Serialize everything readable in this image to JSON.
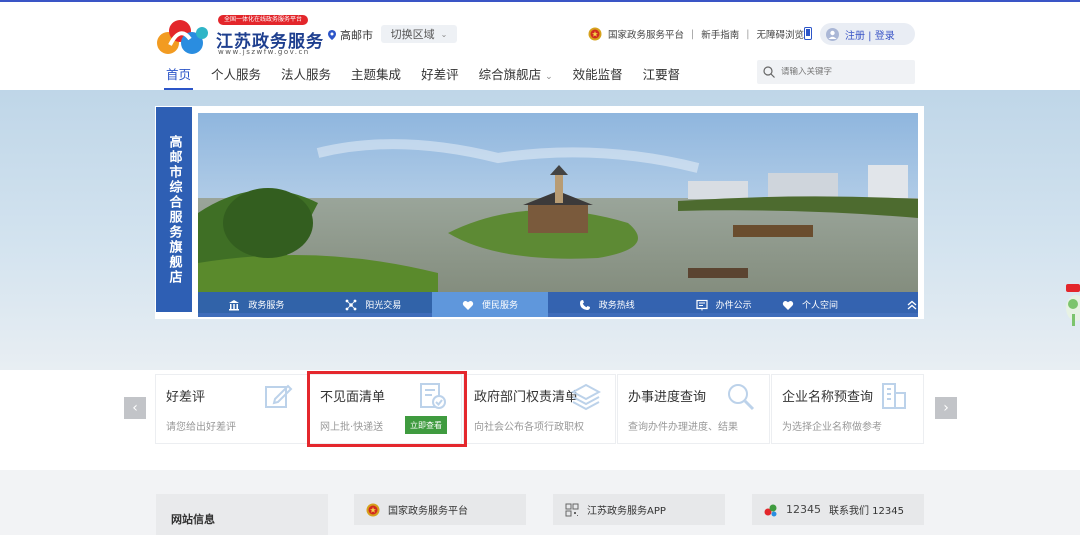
{
  "header": {
    "logo": {
      "badge": "全国一体化在线政务服务平台",
      "title": "江苏政务服务",
      "url": "www.jszwfw.gov.cn"
    },
    "city": "高邮市",
    "switch_area": "切换区域",
    "links": [
      "国家政务服务平台",
      "新手指南",
      "无障碍浏览"
    ],
    "login": "注册 | 登录"
  },
  "nav": {
    "items": [
      "首页",
      "个人服务",
      "法人服务",
      "主题集成",
      "好差评",
      "综合旗舰店",
      "效能监督",
      "江要督"
    ],
    "active_index": 0,
    "search_placeholder": "请输入关键字"
  },
  "store": {
    "side_title": "高邮市综合服务旗舰店",
    "tabs": [
      {
        "label": "政务服务",
        "icon": "government-building-icon"
      },
      {
        "label": "阳光交易",
        "icon": "network-icon"
      },
      {
        "label": "便民服务",
        "icon": "heart-icon"
      },
      {
        "label": "政务热线",
        "icon": "hotline-icon"
      },
      {
        "label": "办件公示",
        "icon": "notice-board-icon"
      },
      {
        "label": "个人空间",
        "icon": "heart-user-icon"
      }
    ],
    "active_tab": 2
  },
  "services": {
    "cards": [
      {
        "title": "好差评",
        "desc": "请您给出好差评",
        "icon": "edit-icon"
      },
      {
        "title": "不见面清单",
        "desc": "网上批·快递送",
        "icon": "document-check-icon",
        "button": "立即查看"
      },
      {
        "title": "政府部门权责清单",
        "desc": "向社会公布各项行政职权",
        "icon": "layers-icon"
      },
      {
        "title": "办事进度查询",
        "desc": "查询办件办理进度、结果",
        "icon": "search-icon"
      },
      {
        "title": "企业名称预查询",
        "desc": "为选择企业名称做参考",
        "icon": "building-icon"
      }
    ]
  },
  "footer": {
    "site_info": "网站信息",
    "links": [
      "国家政务服务平台",
      "江苏政务服务APP",
      "联系我们 12345"
    ],
    "hotline_logo_text": "12345"
  },
  "colors": {
    "brand_blue": "#2c55c8",
    "store_blue": "#2e5fb4",
    "highlight_red": "#e4272d",
    "button_green": "#3f9b3f"
  }
}
